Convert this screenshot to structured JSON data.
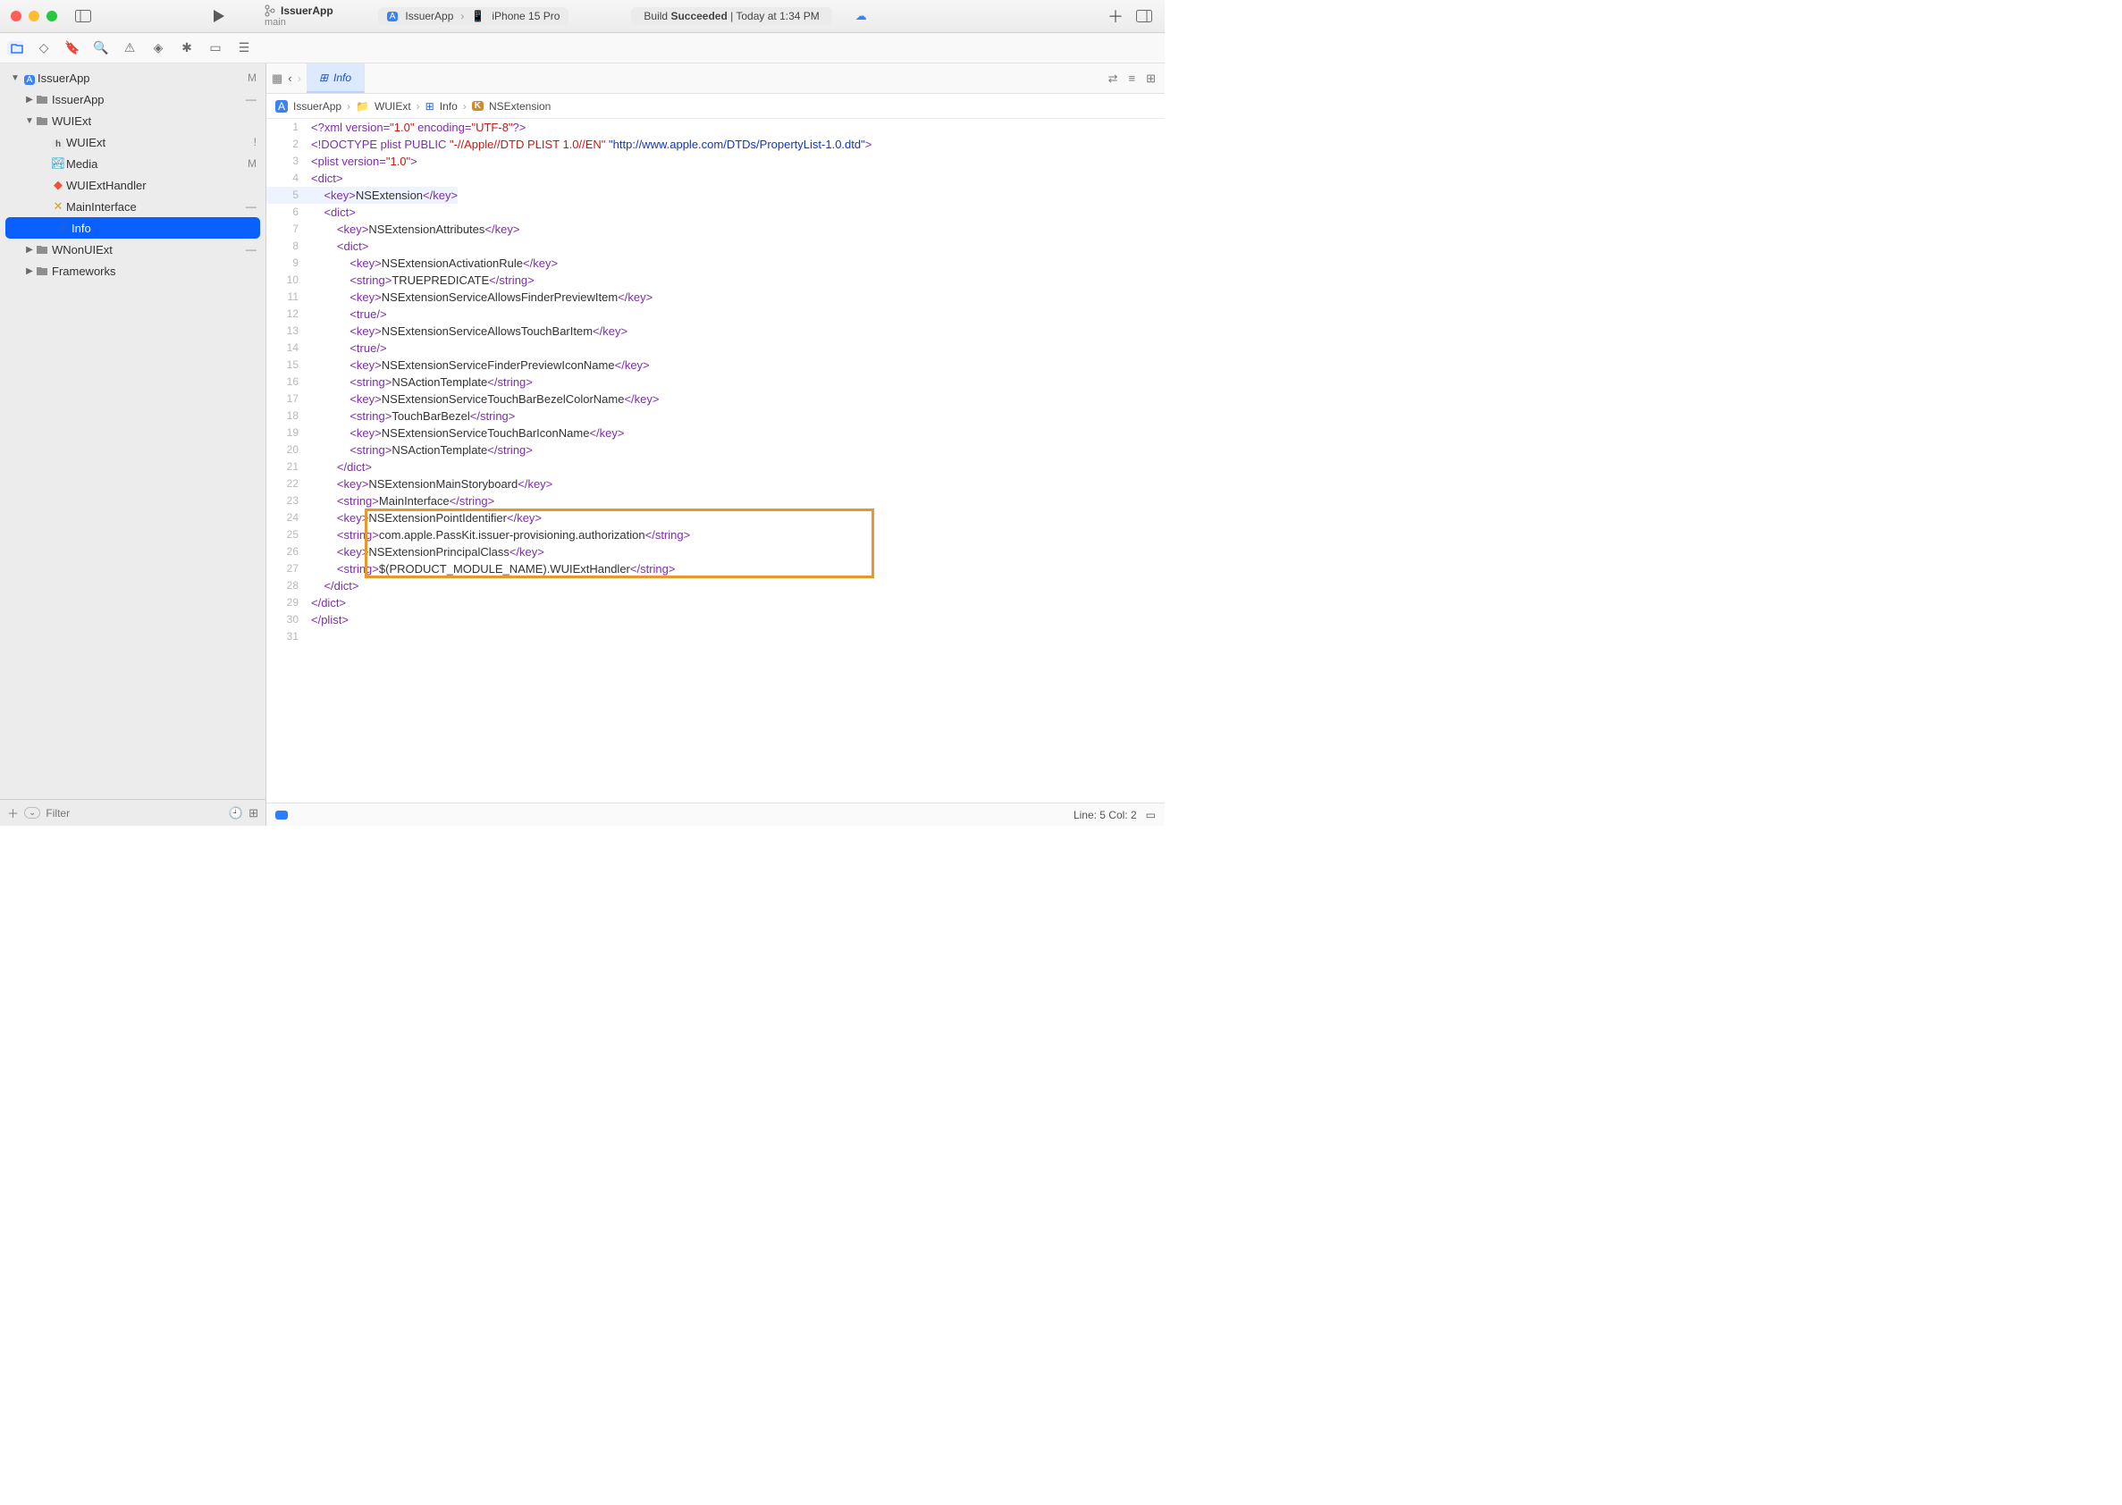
{
  "titlebar": {
    "project": "IssuerApp",
    "branch": "main",
    "scheme_app": "IssuerApp",
    "device": "iPhone 15 Pro",
    "build_status_prefix": "Build ",
    "build_status_bold": "Succeeded",
    "build_status_time": " | Today at 1:34 PM"
  },
  "tabs": {
    "active": "Info"
  },
  "jumpbar": {
    "seg1": "IssuerApp",
    "seg2": "WUIExt",
    "seg3": "Info",
    "seg4": "NSExtension"
  },
  "sidebar": {
    "filter_placeholder": "Filter",
    "items": [
      {
        "label": "IssuerApp",
        "badge": "M",
        "indent": 0,
        "twisty": "▼",
        "icon": "app",
        "sel": false
      },
      {
        "label": "IssuerApp",
        "badge": "—",
        "indent": 1,
        "twisty": "▶",
        "icon": "folder",
        "sel": false
      },
      {
        "label": "WUIExt",
        "badge": "",
        "indent": 1,
        "twisty": "▼",
        "icon": "folder",
        "sel": false
      },
      {
        "label": "WUIExt",
        "badge": "!",
        "indent": 2,
        "twisty": "",
        "icon": "h",
        "sel": false
      },
      {
        "label": "Media",
        "badge": "M",
        "indent": 2,
        "twisty": "",
        "icon": "assets",
        "sel": false
      },
      {
        "label": "WUIExtHandler",
        "badge": "",
        "indent": 2,
        "twisty": "",
        "icon": "swift",
        "sel": false
      },
      {
        "label": "MainInterface",
        "badge": "—",
        "indent": 2,
        "twisty": "",
        "icon": "storyboard",
        "sel": false
      },
      {
        "label": "Info",
        "badge": "",
        "indent": 2,
        "twisty": "",
        "icon": "plist",
        "sel": true
      },
      {
        "label": "WNonUIExt",
        "badge": "—",
        "indent": 1,
        "twisty": "▶",
        "icon": "folder",
        "sel": false
      },
      {
        "label": "Frameworks",
        "badge": "",
        "indent": 1,
        "twisty": "▶",
        "icon": "folder",
        "sel": false
      }
    ]
  },
  "code": {
    "highlighted_line": 5,
    "lines": [
      {
        "n": 1,
        "i": 0,
        "seg": [
          [
            "t-tag",
            "<?xml "
          ],
          [
            "t-attr",
            "version"
          ],
          [
            "t-tag",
            "="
          ],
          [
            "t-str",
            "\"1.0\""
          ],
          [
            "t-tag",
            " "
          ],
          [
            "t-attr",
            "encoding"
          ],
          [
            "t-tag",
            "="
          ],
          [
            "t-str",
            "\"UTF-8\""
          ],
          [
            "t-tag",
            "?>"
          ]
        ]
      },
      {
        "n": 2,
        "i": 0,
        "seg": [
          [
            "t-tag",
            "<!DOCTYPE plist PUBLIC "
          ],
          [
            "t-str",
            "\"-//Apple//DTD PLIST 1.0//EN\""
          ],
          [
            "t-tag",
            " "
          ],
          [
            "t-url",
            "\"http://www.apple.com/DTDs/PropertyList-1.0.dtd\""
          ],
          [
            "t-tag",
            ">"
          ]
        ]
      },
      {
        "n": 3,
        "i": 0,
        "seg": [
          [
            "t-tag",
            "<plist "
          ],
          [
            "t-attr",
            "version"
          ],
          [
            "t-tag",
            "="
          ],
          [
            "t-str",
            "\"1.0\""
          ],
          [
            "t-tag",
            ">"
          ]
        ]
      },
      {
        "n": 4,
        "i": 0,
        "seg": [
          [
            "t-tag",
            "<dict>"
          ]
        ]
      },
      {
        "n": 5,
        "i": 1,
        "seg": [
          [
            "t-tag",
            "<key>"
          ],
          [
            "t-txt",
            "NSExtension"
          ],
          [
            "t-tag",
            "</key>"
          ]
        ],
        "hl": true
      },
      {
        "n": 6,
        "i": 1,
        "seg": [
          [
            "t-tag",
            "<dict>"
          ]
        ]
      },
      {
        "n": 7,
        "i": 2,
        "seg": [
          [
            "t-tag",
            "<key>"
          ],
          [
            "t-txt",
            "NSExtensionAttributes"
          ],
          [
            "t-tag",
            "</key>"
          ]
        ]
      },
      {
        "n": 8,
        "i": 2,
        "seg": [
          [
            "t-tag",
            "<dict>"
          ]
        ]
      },
      {
        "n": 9,
        "i": 3,
        "seg": [
          [
            "t-tag",
            "<key>"
          ],
          [
            "t-txt",
            "NSExtensionActivationRule"
          ],
          [
            "t-tag",
            "</key>"
          ]
        ]
      },
      {
        "n": 10,
        "i": 3,
        "seg": [
          [
            "t-tag",
            "<string>"
          ],
          [
            "t-txt",
            "TRUEPREDICATE"
          ],
          [
            "t-tag",
            "</string>"
          ]
        ]
      },
      {
        "n": 11,
        "i": 3,
        "seg": [
          [
            "t-tag",
            "<key>"
          ],
          [
            "t-txt",
            "NSExtensionServiceAllowsFinderPreviewItem"
          ],
          [
            "t-tag",
            "</key>"
          ]
        ]
      },
      {
        "n": 12,
        "i": 3,
        "seg": [
          [
            "t-tag",
            "<true/>"
          ]
        ]
      },
      {
        "n": 13,
        "i": 3,
        "seg": [
          [
            "t-tag",
            "<key>"
          ],
          [
            "t-txt",
            "NSExtensionServiceAllowsTouchBarItem"
          ],
          [
            "t-tag",
            "</key>"
          ]
        ]
      },
      {
        "n": 14,
        "i": 3,
        "seg": [
          [
            "t-tag",
            "<true/>"
          ]
        ]
      },
      {
        "n": 15,
        "i": 3,
        "seg": [
          [
            "t-tag",
            "<key>"
          ],
          [
            "t-txt",
            "NSExtensionServiceFinderPreviewIconName"
          ],
          [
            "t-tag",
            "</key>"
          ]
        ]
      },
      {
        "n": 16,
        "i": 3,
        "seg": [
          [
            "t-tag",
            "<string>"
          ],
          [
            "t-txt",
            "NSActionTemplate"
          ],
          [
            "t-tag",
            "</string>"
          ]
        ]
      },
      {
        "n": 17,
        "i": 3,
        "seg": [
          [
            "t-tag",
            "<key>"
          ],
          [
            "t-txt",
            "NSExtensionServiceTouchBarBezelColorName"
          ],
          [
            "t-tag",
            "</key>"
          ]
        ]
      },
      {
        "n": 18,
        "i": 3,
        "seg": [
          [
            "t-tag",
            "<string>"
          ],
          [
            "t-txt",
            "TouchBarBezel"
          ],
          [
            "t-tag",
            "</string>"
          ]
        ]
      },
      {
        "n": 19,
        "i": 3,
        "seg": [
          [
            "t-tag",
            "<key>"
          ],
          [
            "t-txt",
            "NSExtensionServiceTouchBarIconName"
          ],
          [
            "t-tag",
            "</key>"
          ]
        ]
      },
      {
        "n": 20,
        "i": 3,
        "seg": [
          [
            "t-tag",
            "<string>"
          ],
          [
            "t-txt",
            "NSActionTemplate"
          ],
          [
            "t-tag",
            "</string>"
          ]
        ]
      },
      {
        "n": 21,
        "i": 2,
        "seg": [
          [
            "t-tag",
            "</dict>"
          ]
        ]
      },
      {
        "n": 22,
        "i": 2,
        "seg": [
          [
            "t-tag",
            "<key>"
          ],
          [
            "t-txt",
            "NSExtensionMainStoryboard"
          ],
          [
            "t-tag",
            "</key>"
          ]
        ]
      },
      {
        "n": 23,
        "i": 2,
        "seg": [
          [
            "t-tag",
            "<string>"
          ],
          [
            "t-txt",
            "MainInterface"
          ],
          [
            "t-tag",
            "</string>"
          ]
        ]
      },
      {
        "n": 24,
        "i": 2,
        "seg": [
          [
            "t-tag",
            "<key>"
          ],
          [
            "t-txt",
            "NSExtensionPointIdentifier"
          ],
          [
            "t-tag",
            "</key>"
          ]
        ],
        "box": true
      },
      {
        "n": 25,
        "i": 2,
        "seg": [
          [
            "t-tag",
            "<string>"
          ],
          [
            "t-txt",
            "com.apple.PassKit.issuer-provisioning.authorization"
          ],
          [
            "t-tag",
            "</string>"
          ]
        ],
        "box": true
      },
      {
        "n": 26,
        "i": 2,
        "seg": [
          [
            "t-tag",
            "<key>"
          ],
          [
            "t-txt",
            "NSExtensionPrincipalClass"
          ],
          [
            "t-tag",
            "</key>"
          ]
        ],
        "box": true
      },
      {
        "n": 27,
        "i": 2,
        "seg": [
          [
            "t-tag",
            "<string>"
          ],
          [
            "t-txt",
            "$(PRODUCT_MODULE_NAME).WUIExtHandler"
          ],
          [
            "t-tag",
            "</string>"
          ]
        ],
        "box": true
      },
      {
        "n": 28,
        "i": 1,
        "seg": [
          [
            "t-tag",
            "</dict>"
          ]
        ]
      },
      {
        "n": 29,
        "i": 0,
        "seg": [
          [
            "t-tag",
            "</dict>"
          ]
        ]
      },
      {
        "n": 30,
        "i": 0,
        "seg": [
          [
            "t-tag",
            "</plist>"
          ]
        ]
      },
      {
        "n": 31,
        "i": 0,
        "seg": []
      }
    ]
  },
  "statusbar": {
    "lineinfo": "Line: 5  Col: 2"
  },
  "icons": {
    "folder": "📁",
    "app": "🅰",
    "h": "h",
    "assets": "🏞",
    "swift": "🕊",
    "storyboard": "✕",
    "plist": "⊞"
  }
}
